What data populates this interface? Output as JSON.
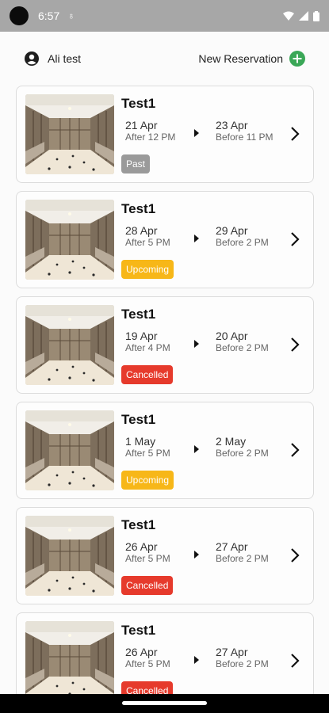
{
  "status_bar": {
    "time": "6:57"
  },
  "header": {
    "user_name": "Ali test",
    "new_reservation_label": "New Reservation"
  },
  "colors": {
    "past": "#9a9a9a",
    "upcoming": "#f7b718",
    "cancelled": "#e63a2c",
    "accent_green": "#3aa757"
  },
  "reservations": [
    {
      "title": "Test1",
      "start_date": "21 Apr",
      "start_time": "After 12 PM",
      "end_date": "23 Apr",
      "end_time": "Before 11 PM",
      "status": "Past",
      "status_key": "past"
    },
    {
      "title": "Test1",
      "start_date": "28 Apr",
      "start_time": "After 5 PM",
      "end_date": "29 Apr",
      "end_time": "Before 2 PM",
      "status": "Upcoming",
      "status_key": "upcoming"
    },
    {
      "title": "Test1",
      "start_date": "19 Apr",
      "start_time": "After 4 PM",
      "end_date": "20 Apr",
      "end_time": "Before 2 PM",
      "status": "Cancelled",
      "status_key": "cancelled"
    },
    {
      "title": "Test1",
      "start_date": "1 May",
      "start_time": "After 5 PM",
      "end_date": "2 May",
      "end_time": "Before 2 PM",
      "status": "Upcoming",
      "status_key": "upcoming"
    },
    {
      "title": "Test1",
      "start_date": "26 Apr",
      "start_time": "After 5 PM",
      "end_date": "27 Apr",
      "end_time": "Before 2 PM",
      "status": "Cancelled",
      "status_key": "cancelled"
    },
    {
      "title": "Test1",
      "start_date": "26 Apr",
      "start_time": "After 5 PM",
      "end_date": "27 Apr",
      "end_time": "Before 2 PM",
      "status": "Cancelled",
      "status_key": "cancelled"
    }
  ]
}
